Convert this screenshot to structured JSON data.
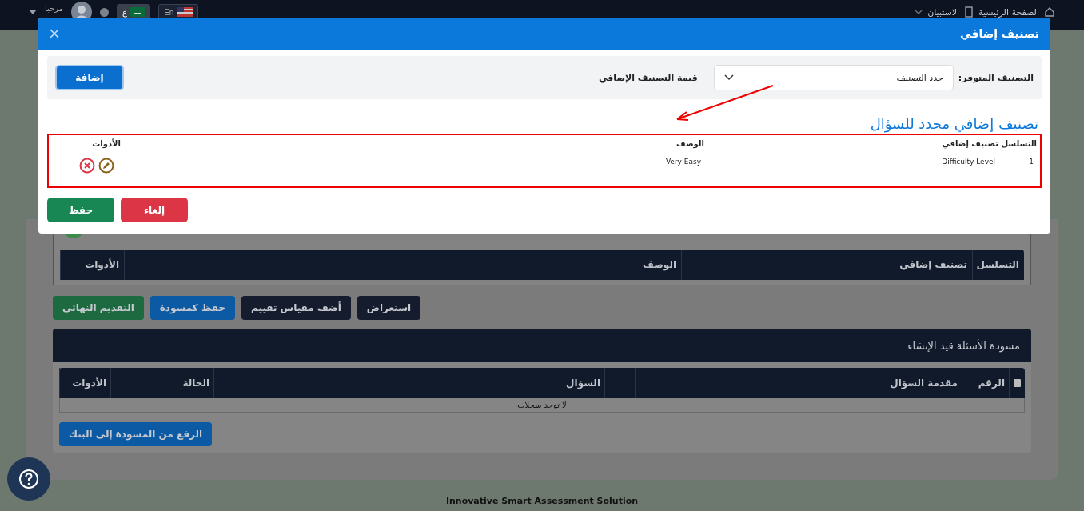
{
  "navbar": {
    "home": "الصفحة الرئيسية",
    "survey": "الاستبيان",
    "greeting": "مرحبا",
    "lang_ar": "ع",
    "lang_en": "En"
  },
  "modal": {
    "title": "تصنيف إضافي",
    "filter": {
      "label": "التصنيف المتوفر:",
      "select_value": "حدد التصنيف",
      "value_label": "قيمة التصنيف الإضافي",
      "add_button": "إضافة"
    },
    "section_title": "تصنيف إضافي محدد للسؤال",
    "table": {
      "columns": [
        "التسلسل",
        "تصنيف إضافي",
        "الوصف",
        "الأدوات"
      ],
      "rows": [
        {
          "seq": "1",
          "classification": "Difficulty Level",
          "description": "Very Easy"
        }
      ]
    },
    "buttons": [
      {
        "label": "إلغاء",
        "kind": "cancel"
      },
      {
        "label": "حفظ",
        "kind": "save"
      }
    ]
  },
  "background": {
    "classification_table": {
      "columns": [
        "التسلسل",
        "تصنيف إضافي",
        "الوصف",
        "الأدوات"
      ]
    },
    "actions": [
      {
        "label": "استعراض",
        "kind": "dark"
      },
      {
        "label": "أضف مقياس تقييم",
        "kind": "dark"
      },
      {
        "label": "حفظ كمسودة",
        "kind": "blue"
      },
      {
        "label": "التقديم النهائي",
        "kind": "green"
      }
    ],
    "draft": {
      "title": "مسودة الأسئلة قيد الإنشاء",
      "select_all_checked": false,
      "columns": [
        "الرقم",
        "مقدمة السؤال",
        "",
        "السؤال",
        "الحالة",
        "الأدوات"
      ],
      "empty": "لا توجد سجلات",
      "upload_button": "الرفع من المسودة إلى البنك"
    }
  },
  "footer": "Innovative Smart Assessment Solution"
}
